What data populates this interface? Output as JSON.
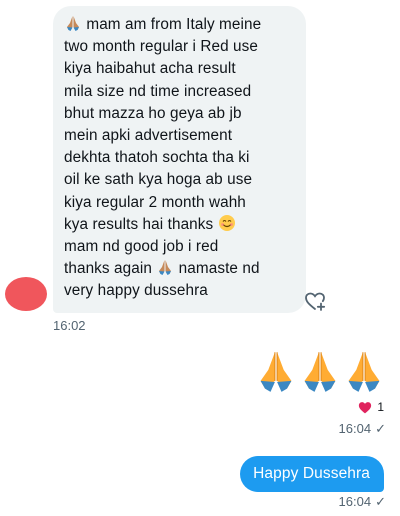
{
  "incoming": {
    "lines": [
      "mam am from Italy meine",
      "two month regular  i Red use",
      "kiya haibahut acha result",
      "mila size nd time increased",
      "bhut mazza ho geya ab jb",
      "mein apki advertisement",
      "dekhta thatoh sochta tha ki",
      "oil ke sath kya hoga ab use",
      "kiya regular 2 month wahh",
      "kya results hai thanks",
      "mam nd good job i red",
      "thanks again",
      "namaste nd",
      "very happy dussehra"
    ],
    "time": "16:02"
  },
  "outgoing": {
    "emoji_message": [
      "folded-hands",
      "folded-hands",
      "folded-hands"
    ],
    "reaction": {
      "emoji": "heart",
      "count": "1"
    },
    "time_1": "16:04",
    "text_message": "Happy Dussehra",
    "time_2": "16:04",
    "read_mark": "✓"
  },
  "colors": {
    "incoming_bubble": "#eff3f4",
    "outgoing_bubble": "#1d9bf0",
    "timestamp": "#536471",
    "heart": "#e0245e"
  }
}
